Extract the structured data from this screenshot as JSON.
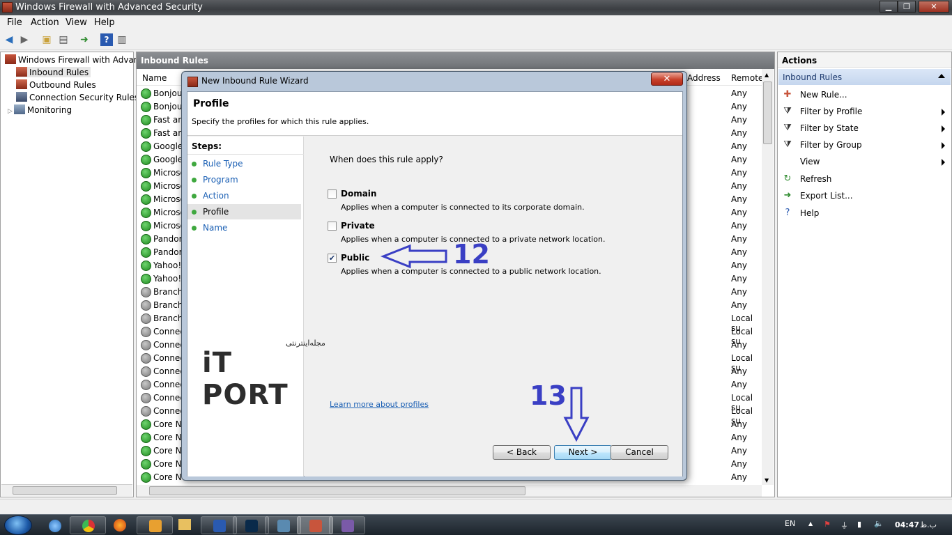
{
  "window": {
    "title": "Windows Firewall with Advanced Security"
  },
  "menu": [
    "File",
    "Action",
    "View",
    "Help"
  ],
  "tree": {
    "root": "Windows Firewall with Advance",
    "items": [
      "Inbound Rules",
      "Outbound Rules",
      "Connection Security Rules",
      "Monitoring"
    ]
  },
  "center": {
    "title": "Inbound Rules",
    "columns": {
      "name": "Name",
      "address": "Address",
      "remote": "Remote"
    },
    "rows": [
      {
        "name": "Bonjour",
        "status": "enabled",
        "remote": "Any"
      },
      {
        "name": "Bonjour",
        "status": "enabled",
        "remote": "Any"
      },
      {
        "name": "Fast and",
        "status": "enabled",
        "remote": "Any"
      },
      {
        "name": "Fast and",
        "status": "enabled",
        "remote": "Any"
      },
      {
        "name": "Google",
        "status": "enabled",
        "remote": "Any"
      },
      {
        "name": "Google",
        "status": "enabled",
        "remote": "Any"
      },
      {
        "name": "Microsc",
        "status": "enabled",
        "remote": "Any"
      },
      {
        "name": "Microsc",
        "status": "enabled",
        "remote": "Any"
      },
      {
        "name": "Microsc",
        "status": "enabled",
        "remote": "Any"
      },
      {
        "name": "Microsc",
        "status": "enabled",
        "remote": "Any"
      },
      {
        "name": "Microsc",
        "status": "enabled",
        "remote": "Any"
      },
      {
        "name": "Pandora",
        "status": "enabled",
        "remote": "Any"
      },
      {
        "name": "Pandora",
        "status": "enabled",
        "remote": "Any"
      },
      {
        "name": "Yahoo!",
        "status": "enabled",
        "remote": "Any"
      },
      {
        "name": "Yahoo!",
        "status": "enabled",
        "remote": "Any"
      },
      {
        "name": "BranchC",
        "status": "disabled",
        "remote": "Any"
      },
      {
        "name": "BranchC",
        "status": "disabled",
        "remote": "Any"
      },
      {
        "name": "BranchC",
        "status": "disabled",
        "remote": "Local su"
      },
      {
        "name": "Connec",
        "status": "disabled",
        "remote": "Local su"
      },
      {
        "name": "Connec",
        "status": "disabled",
        "remote": "Any"
      },
      {
        "name": "Connec",
        "status": "disabled",
        "remote": "Local su"
      },
      {
        "name": "Connec",
        "status": "disabled",
        "remote": "Any"
      },
      {
        "name": "Connec",
        "status": "disabled",
        "remote": "Any"
      },
      {
        "name": "Connec",
        "status": "disabled",
        "remote": "Local su"
      },
      {
        "name": "Connec",
        "status": "disabled",
        "remote": "Local su"
      },
      {
        "name": "Core Ne",
        "status": "enabled",
        "remote": "Any"
      },
      {
        "name": "Core Ne",
        "status": "enabled",
        "remote": "Any"
      },
      {
        "name": "Core Ne",
        "status": "enabled",
        "remote": "Any"
      },
      {
        "name": "Core Ne",
        "status": "enabled",
        "remote": "Any"
      },
      {
        "name": "Core Ne",
        "status": "enabled",
        "remote": "Any"
      }
    ]
  },
  "actions": {
    "title": "Actions",
    "section": "Inbound Rules",
    "items": [
      {
        "label": "New Rule...",
        "icon": "new-rule-icon",
        "submenu": false
      },
      {
        "label": "Filter by Profile",
        "icon": "filter-icon",
        "submenu": true
      },
      {
        "label": "Filter by State",
        "icon": "filter-icon",
        "submenu": true
      },
      {
        "label": "Filter by Group",
        "icon": "filter-icon",
        "submenu": true
      },
      {
        "label": "View",
        "icon": "",
        "submenu": true
      },
      {
        "label": "Refresh",
        "icon": "refresh-icon",
        "submenu": false
      },
      {
        "label": "Export List...",
        "icon": "export-icon",
        "submenu": false
      },
      {
        "label": "Help",
        "icon": "help-icon",
        "submenu": false
      }
    ]
  },
  "dialog": {
    "title": "New Inbound Rule Wizard",
    "close": "✕",
    "header": "Profile",
    "subheader": "Specify the profiles for which this rule applies.",
    "steps_title": "Steps:",
    "steps": [
      "Rule Type",
      "Program",
      "Action",
      "Profile",
      "Name"
    ],
    "current_step": "Profile",
    "question": "When does this rule apply?",
    "options": [
      {
        "label": "Domain",
        "desc": "Applies when a computer is connected to its corporate domain.",
        "checked": false
      },
      {
        "label": "Private",
        "desc": "Applies when a computer is connected to a private network location.",
        "checked": false
      },
      {
        "label": "Public",
        "desc": "Applies when a computer is connected to a public network location.",
        "checked": true
      }
    ],
    "learn_more": "Learn more about profiles",
    "buttons": {
      "back": "< Back",
      "next": "Next >",
      "cancel": "Cancel"
    }
  },
  "annotations": {
    "step12": "12",
    "step13": "13"
  },
  "logo": {
    "text": "iT PORT",
    "subtitle": "مجله‌اینترنتی"
  },
  "tray": {
    "lang": "EN",
    "clock": "04:47",
    "period": "ب.ظ"
  },
  "colors": {
    "accent": "#3a3fc4",
    "enabled": "#1f8a1f",
    "link": "#1a5fb4"
  }
}
